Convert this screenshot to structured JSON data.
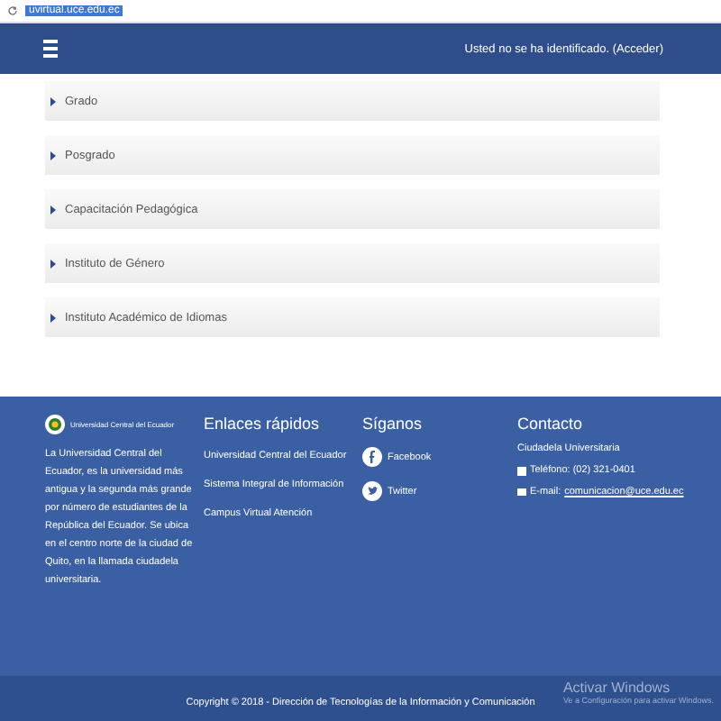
{
  "browser": {
    "address": "uvirtual.uce.edu.ec"
  },
  "header": {
    "user_status": "Usted no se ha identificado. (Acceder)"
  },
  "sections": [
    {
      "label": "Grado",
      "expanded": false
    },
    {
      "label": "Posgrado",
      "expanded": false
    },
    {
      "label": "Capacitación Pedagógica",
      "expanded": false
    },
    {
      "label": "Instituto de Género",
      "expanded": false
    },
    {
      "label": "Instituto Académico de Idiomas",
      "expanded": false
    }
  ],
  "footer": {
    "logo_text": "Universidad Central del Ecuador",
    "about": "La Universidad Central del Ecuador, es la universidad más antigua y la segunda más grande por número de estudiantes de la República del Ecuador. Se ubica en el centro norte de la ciudad de Quito, en la llamada ciudadela universitaria.",
    "links_title": "Enlaces rápidos",
    "links": [
      "Universidad Central del Ecuador",
      "Sistema Integral de Información",
      "Campus Virtual Atención"
    ],
    "social_title": "Síganos",
    "social": [
      {
        "kind": "facebook",
        "label": "Facebook"
      },
      {
        "kind": "twitter",
        "label": "Twitter"
      }
    ],
    "contact_title": "Contacto",
    "contact_address": "Ciudadela Universitaria",
    "contact_phone": "Teléfono: (02) 321-0401",
    "contact_email_label": "E-mail:",
    "contact_email": "comunicacion@uce.edu.ec"
  },
  "copyright": "Copyright © 2018 - Dirección de Tecnologías de la Información y Comunicación",
  "activation": {
    "title": "Activar Windows",
    "subtitle": "Ve a Configuración para activar Windows."
  }
}
